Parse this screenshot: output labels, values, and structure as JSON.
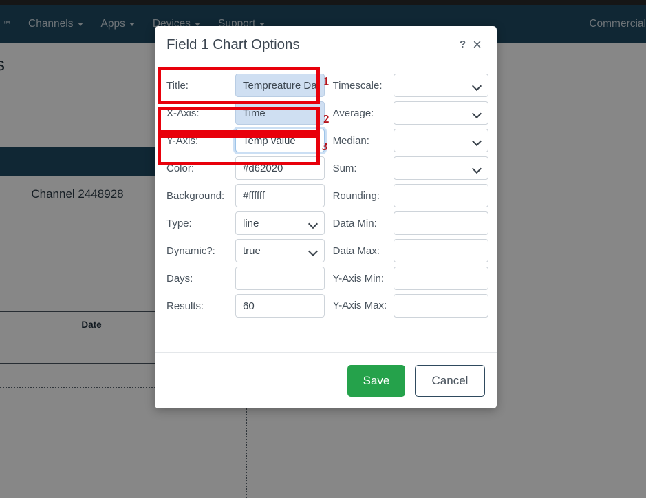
{
  "navbar": {
    "brand": "™",
    "items": [
      {
        "label": "Channels",
        "icon": "chevron-down-icon"
      },
      {
        "label": "Apps",
        "icon": "chevron-down-icon"
      },
      {
        "label": "Devices",
        "icon": "chevron-down-icon"
      },
      {
        "label": "Support",
        "icon": "chevron-down-icon"
      }
    ],
    "right_label": "Commercial",
    "bg_color": "#1f4a63"
  },
  "background": {
    "page_heading": "s",
    "channel_title": "Channel 2448928",
    "table_header_date": "Date"
  },
  "dialog": {
    "title": "Field 1 Chart Options",
    "help_icon": "?",
    "close_icon": "×",
    "left_fields": [
      {
        "label": "Title:",
        "value": "Tempreature Da",
        "kind": "text",
        "state": "highlighted",
        "name": "title"
      },
      {
        "label": "X-Axis:",
        "value": "Time",
        "kind": "text",
        "state": "highlighted",
        "name": "x-axis"
      },
      {
        "label": "Y-Axis:",
        "value": "Temp value",
        "kind": "text",
        "state": "focused",
        "name": "y-axis"
      },
      {
        "label": "Color:",
        "value": "#d62020",
        "kind": "text",
        "state": "normal",
        "name": "color"
      },
      {
        "label": "Background:",
        "value": "#ffffff",
        "kind": "text",
        "state": "normal",
        "name": "background"
      },
      {
        "label": "Type:",
        "value": "line",
        "kind": "select",
        "state": "normal",
        "name": "type"
      },
      {
        "label": "Dynamic?:",
        "value": "true",
        "kind": "select",
        "state": "normal",
        "name": "dynamic"
      },
      {
        "label": "Days:",
        "value": "",
        "kind": "text",
        "state": "normal",
        "name": "days"
      },
      {
        "label": "Results:",
        "value": "60",
        "kind": "text",
        "state": "normal",
        "name": "results"
      }
    ],
    "right_fields": [
      {
        "label": "Timescale:",
        "value": "",
        "kind": "select",
        "name": "timescale",
        "wrap": false
      },
      {
        "label": "Average:",
        "value": "",
        "kind": "select",
        "name": "average",
        "wrap": false
      },
      {
        "label": "Median:",
        "value": "",
        "kind": "select",
        "name": "median",
        "wrap": false
      },
      {
        "label": "Sum:",
        "value": "",
        "kind": "select",
        "name": "sum",
        "wrap": false
      },
      {
        "label": "Rounding:",
        "value": "",
        "kind": "text",
        "name": "rounding",
        "wrap": false
      },
      {
        "label": "Data Min:",
        "value": "",
        "kind": "text",
        "name": "data-min",
        "wrap": false
      },
      {
        "label": "Data Max:",
        "value": "",
        "kind": "text",
        "name": "data-max",
        "wrap": false
      },
      {
        "label": "Y-Axis Min:",
        "value": "",
        "kind": "text",
        "name": "y-axis-min",
        "wrap": false
      },
      {
        "label": "Y-Axis Max:",
        "value": "",
        "kind": "text",
        "name": "y-axis-max",
        "wrap": true
      }
    ],
    "save_label": "Save",
    "cancel_label": "Cancel"
  },
  "annotations": {
    "color": "#e8000b",
    "markers": [
      {
        "number": "1",
        "target": "Title field"
      },
      {
        "number": "2",
        "target": "X-Axis field"
      },
      {
        "number": "3",
        "target": "Y-Axis field"
      }
    ]
  }
}
